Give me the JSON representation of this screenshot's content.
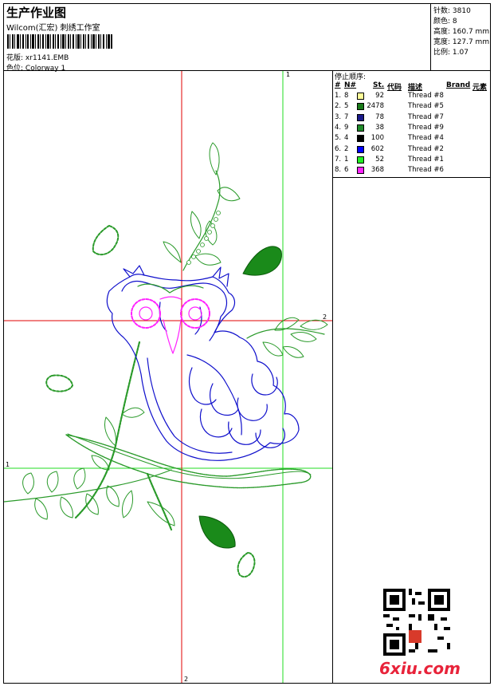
{
  "header": {
    "title": "生产作业图",
    "company": "Wilcom(汇宏) 刺绣工作室",
    "design_label": "花版:",
    "design_value": "xr1141.EMB",
    "colorway_label": "色位:",
    "colorway_value": "Colorway 1"
  },
  "stats": {
    "stitches_label": "针数:",
    "stitches": "3810",
    "colors_label": "颜色:",
    "colors": "8",
    "height_label": "高度:",
    "height": "160.7 mm",
    "width_label": "宽度:",
    "width": "127.7 mm",
    "scale_label": "比例:",
    "scale": "1.07"
  },
  "stop_sequence": {
    "title": "停止顺序:",
    "headers": {
      "num": "#",
      "n": "N#",
      "st": "St.",
      "code": "代码",
      "desc": "描述",
      "brand": "Brand",
      "elem": "元素"
    },
    "rows": [
      {
        "num": "1.",
        "n": "8",
        "st": "92",
        "desc": "Thread #8",
        "color": "#ffff99"
      },
      {
        "num": "2.",
        "n": "5",
        "st": "2478",
        "desc": "Thread #5",
        "color": "#1a7a1a"
      },
      {
        "num": "3.",
        "n": "7",
        "st": "78",
        "desc": "Thread #7",
        "color": "#1a1a8a"
      },
      {
        "num": "4.",
        "n": "9",
        "st": "38",
        "desc": "Thread #9",
        "color": "#1f8a2a"
      },
      {
        "num": "5.",
        "n": "4",
        "st": "100",
        "desc": "Thread #4",
        "color": "#000000"
      },
      {
        "num": "6.",
        "n": "2",
        "st": "602",
        "desc": "Thread #2",
        "color": "#0000ff"
      },
      {
        "num": "7.",
        "n": "1",
        "st": "52",
        "desc": "Thread #1",
        "color": "#22ee22"
      },
      {
        "num": "8.",
        "n": "6",
        "st": "368",
        "desc": "Thread #6",
        "color": "#ff22ff"
      }
    ]
  },
  "guides": {
    "green_v": "1",
    "green_h": "1",
    "red_h": "2",
    "red_v": "2"
  },
  "watermark": "6xiu.com"
}
